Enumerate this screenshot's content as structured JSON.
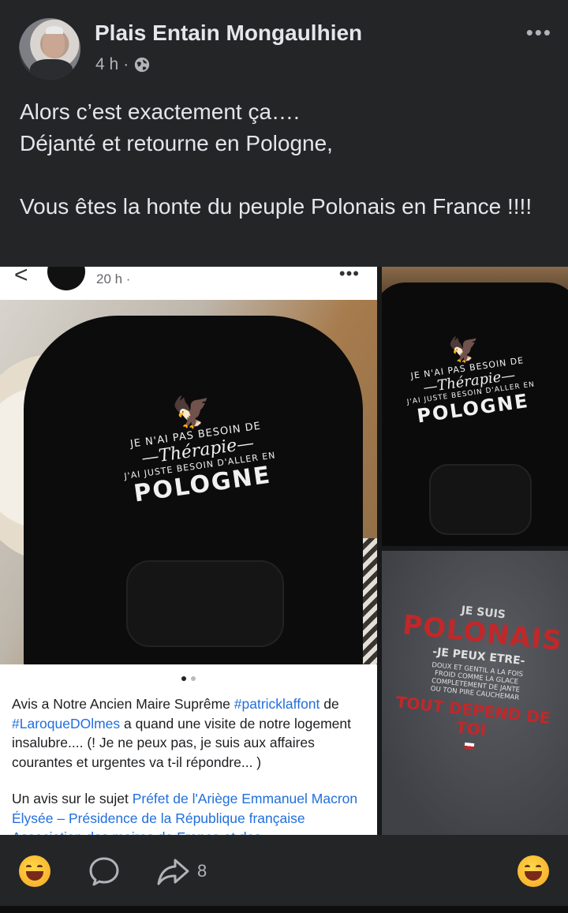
{
  "post": {
    "author": "Plais Entain Mongaulhien",
    "time": "4 h",
    "separator": "·",
    "privacy_icon": "globe-icon",
    "more_label": "•••",
    "text_lines": [
      "Alors c’est exactement ça….\nDéjanté et retourne en Pologne,",
      "Vous êtes la honte du peuple Polonais en France !!!!"
    ]
  },
  "gallery": {
    "main": {
      "shot_time": "20 h ·",
      "back_icon": "<",
      "more_label": "•••",
      "print": {
        "line1": "JE N'AI PAS BESOIN DE",
        "line2": "—Thérapie—",
        "line3": "J'AI JUSTE BESOIN D'ALLER EN",
        "line4": "POLOGNE"
      },
      "caption": {
        "p1_a": "Avis a Notre Ancien Maire Suprême ",
        "p1_link1": "#patricklaffont",
        "p1_b": " de ",
        "p1_link2": "#LaroqueDOlmes",
        "p1_c": " a quand une visite de notre logement insalubre.... (! Je ne peux pas, je suis aux affaires courantes et urgentes va t-il répondre... )",
        "p2_a": "Un avis sur le sujet ",
        "p2_link": "Préfet de l'Ariège Emmanuel Macron Élysée – Présidence de la République française Association des maires de France et des"
      }
    },
    "top_right": {
      "print": {
        "line1": "JE N'AI PAS BESOIN DE",
        "line2": "—Thérapie—",
        "line3": "J'AI JUSTE BESOIN D'ALLER EN",
        "line4": "POLOGNE"
      }
    },
    "bottom_right": {
      "print": {
        "a": "JE SUIS",
        "b": "POLONAIS",
        "c": "-JE PEUX ETRE-",
        "d": "DOUX ET GENTIL A LA FOIS\nFROID COMME LA GLACE\nCOMPLETEMENT DE JANTE\nOU TON PIRE CAUCHEMAR",
        "e": "TOUT DEPEND DE TOI"
      }
    }
  },
  "actions": {
    "reaction_icon": "laughing-emoji-icon",
    "comment_icon": "comment-icon",
    "share_icon": "share-icon",
    "share_count": "8",
    "react_button_icon": "laughing-emoji-icon"
  }
}
